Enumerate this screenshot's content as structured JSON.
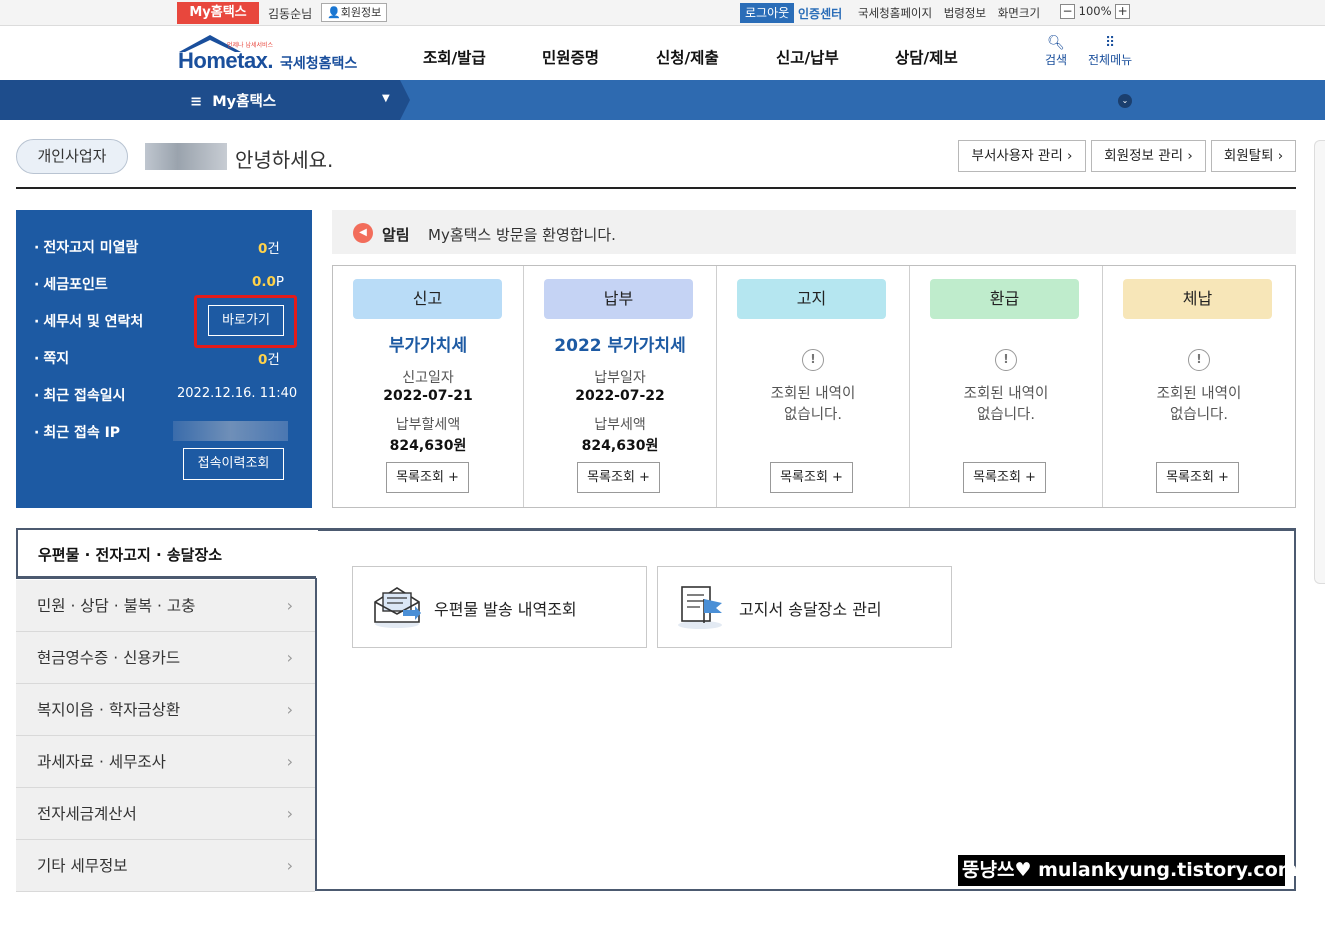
{
  "topbar": {
    "my_tab": "My홈택스",
    "user_name": "김동순님",
    "member_info": "회원정보",
    "logout": "로그아웃",
    "cert_center": "인증센터",
    "links": [
      "국세청홈페이지",
      "법령정보",
      "화면크기"
    ],
    "zoom": "100%",
    "zoom_minus": "−",
    "zoom_plus": "+"
  },
  "header": {
    "logo_main": "Hometax.",
    "logo_sub": "국세청홈택스",
    "logo_tiny": "언제나 납세서비스",
    "menu": [
      "조회/발급",
      "민원증명",
      "신청/제출",
      "신고/납부",
      "상담/제보"
    ],
    "search_label": "검색",
    "all_menu_label": "전체메뉴"
  },
  "nav": {
    "title": "My홈택스"
  },
  "greeting": {
    "user_type": "개인사업자",
    "hello": "안녕하세요.",
    "buttons": [
      "부서사용자 관리 ›",
      "회원정보 관리 ›",
      "회원탈퇴 ›"
    ]
  },
  "info": {
    "rows": [
      {
        "label": "전자고지 미열람",
        "num": "0",
        "unit": "건"
      },
      {
        "label": "세금포인트",
        "num": "0.0",
        "unit": "P"
      },
      {
        "label": "세무서 및 연락처",
        "num": "",
        "unit": ""
      },
      {
        "label": "쪽지",
        "num": "0",
        "unit": "건"
      },
      {
        "label": "최근 접속일시",
        "num": "",
        "unit": "2022.12.16.  11:40"
      },
      {
        "label": "최근 접속 IP",
        "num": "",
        "unit": ""
      }
    ],
    "go_button": "바로가기",
    "history_button": "접속이력조회"
  },
  "notice": {
    "title": "알림",
    "text": "My홈택스 방문을 환영합니다."
  },
  "cards": [
    {
      "chip": "신고",
      "color": "#b9dcf7",
      "title": "부가가치세",
      "sub1": "신고일자",
      "val1": "2022-07-21",
      "sub2": "납부할세액",
      "val2": "824,630원",
      "empty": "",
      "button": "목록조회 +"
    },
    {
      "chip": "납부",
      "color": "#c5d3f4",
      "title": "2022 부가가치세",
      "sub1": "납부일자",
      "val1": "2022-07-22",
      "sub2": "납부세액",
      "val2": "824,630원",
      "empty": "",
      "button": "목록조회 +"
    },
    {
      "chip": "고지",
      "color": "#b5e6f0",
      "title": "",
      "sub1": "",
      "val1": "",
      "sub2": "",
      "val2": "",
      "empty": "조회된 내역이\n없습니다.",
      "button": "목록조회 +"
    },
    {
      "chip": "환급",
      "color": "#bfeccc",
      "title": "",
      "sub1": "",
      "val1": "",
      "sub2": "",
      "val2": "",
      "empty": "조회된 내역이\n없습니다.",
      "button": "목록조회 +"
    },
    {
      "chip": "체납",
      "color": "#f7e6b8",
      "title": "",
      "sub1": "",
      "val1": "",
      "sub2": "",
      "val2": "",
      "empty": "조회된 내역이\n없습니다.",
      "button": "목록조회 +"
    }
  ],
  "bottom": {
    "active_tab": "우편물 · 전자고지 · 송달장소",
    "side_items": [
      "민원 · 상담 · 불복 · 고충",
      "현금영수증 · 신용카드",
      "복지이음 · 학자금상환",
      "과세자료 · 세무조사",
      "전자세금계산서",
      "기타 세무정보"
    ],
    "services": [
      "우편물 발송 내역조회",
      "고지서 송달장소 관리"
    ]
  },
  "watermark": "뚱냥쓰♥ mulankyung.tistory.com"
}
